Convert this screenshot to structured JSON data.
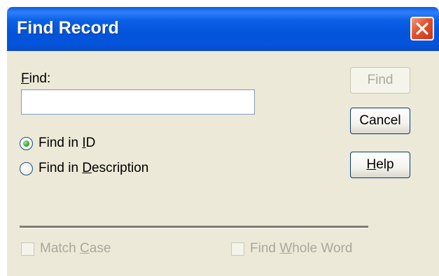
{
  "window": {
    "title": "Find Record"
  },
  "form": {
    "find_label_prefix": "",
    "find_label_mnemonic": "F",
    "find_label_rest": "ind:",
    "find_value": "",
    "radios": [
      {
        "pre": "Find in ",
        "mnemonic": "I",
        "post": "D",
        "selected": true
      },
      {
        "pre": "Find in ",
        "mnemonic": "D",
        "post": "escription",
        "selected": false
      }
    ],
    "checkboxes": [
      {
        "pre": "Match ",
        "mnemonic": "C",
        "post": "ase",
        "checked": false,
        "enabled": false
      },
      {
        "pre": "Find ",
        "mnemonic": "W",
        "post": "hole Word",
        "checked": false,
        "enabled": false
      }
    ]
  },
  "buttons": {
    "find": "Find",
    "cancel": "Cancel",
    "help_mnemonic": "H",
    "help_rest": "elp"
  },
  "colors": {
    "titlebar": "#0454dc",
    "dialog_bg": "#ece9d8",
    "close": "#e2502c",
    "radio_dot": "#22a01e"
  }
}
